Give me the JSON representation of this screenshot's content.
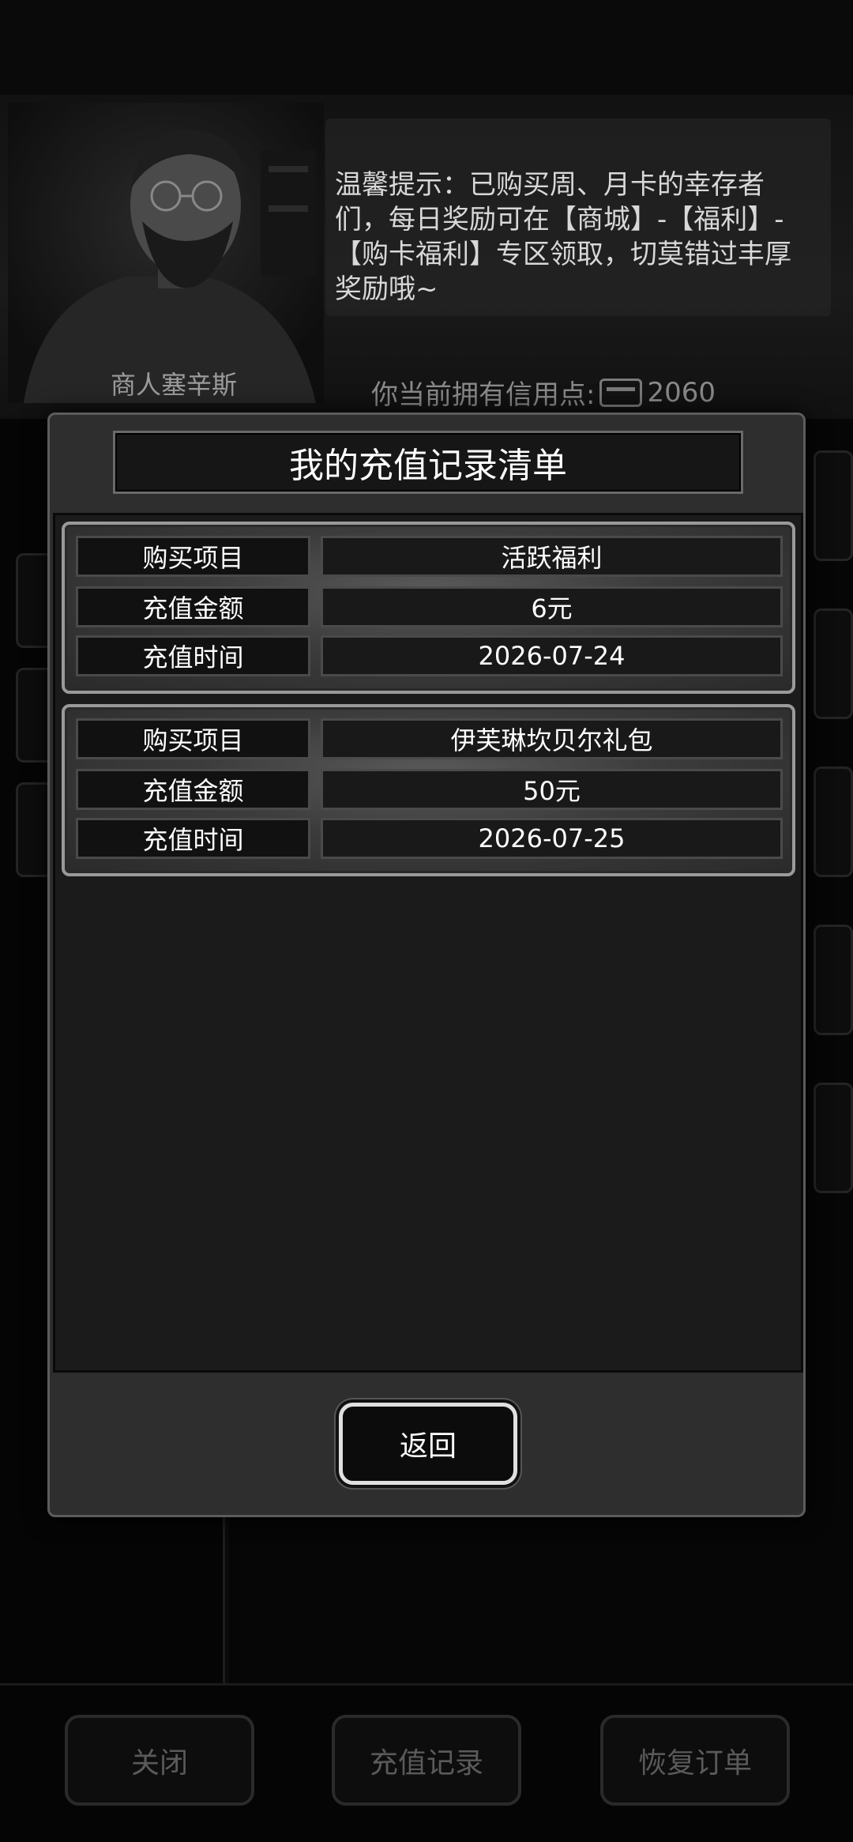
{
  "merchant": {
    "name": "商人塞辛斯",
    "hint": "温馨提示：已购买周、月卡的幸存者们，每日奖励可在【商城】-【福利】-【购卡福利】专区领取，切莫错过丰厚奖励哦~",
    "credits_label": "你当前拥有信用点:",
    "credits_value": "2060",
    "credits_icon": "credit-card-icon"
  },
  "modal": {
    "title": "我的充值记录清单",
    "records": [
      {
        "item_label": "购买项目",
        "item_value": "活跃福利",
        "amount_label": "充值金额",
        "amount_value": "6元",
        "time_label": "充值时间",
        "time_value": "2026-07-24"
      },
      {
        "item_label": "购买项目",
        "item_value": "伊芙琳坎贝尔礼包",
        "amount_label": "充值金额",
        "amount_value": "50元",
        "time_label": "充值时间",
        "time_value": "2026-07-25"
      }
    ],
    "back_label": "返回"
  },
  "bottom_bar": {
    "close_label": "关闭",
    "history_label": "充值记录",
    "restore_label": "恢复订单"
  },
  "colors": {
    "modal_bg": "#2e2e2e",
    "title_box_bg": "#161616",
    "list_bg": "#1b1b1b",
    "record_border": "#9a9a9a"
  }
}
